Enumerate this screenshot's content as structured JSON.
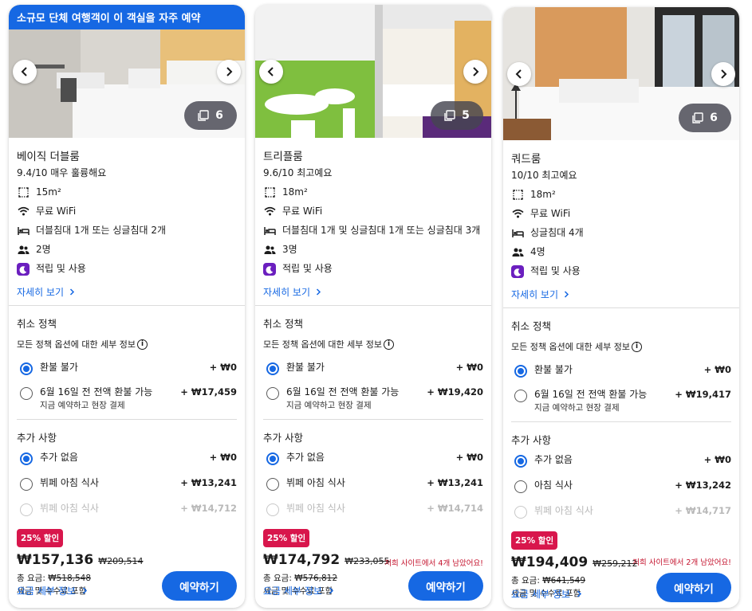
{
  "cards": [
    {
      "banner": "소규모 단체 여행객이 이 객실을 자주 예약",
      "photo_count": "6",
      "name": "베이직 더블룸",
      "rating": "9.4/10 매우 훌륭해요",
      "size": "15m²",
      "wifi": "무료 WiFi",
      "beds": "더블침대 1개 또는 싱글침대 2개",
      "guests": "2명",
      "points": "적립 및 사용",
      "details_link": "자세히 보기",
      "cancel_title": "취소 정책",
      "cancel_sub": "모든 정책 옵션에 대한 세부 정보",
      "cancel_options": [
        {
          "label": "환불 불가",
          "sub": "",
          "price": "+ ₩0"
        },
        {
          "label": "6월 16일 전 전액 환불 가능",
          "sub": "지금 예약하고 현장 결제",
          "price": "+ ₩17,459"
        }
      ],
      "extras_title": "추가 사항",
      "extras": [
        {
          "label": "추가 없음",
          "price": "+ ₩0"
        },
        {
          "label": "뷔페 아침 식사",
          "price": "+ ₩13,241"
        },
        {
          "label": "뷔페 아침 식사",
          "price": "+ ₩14,712"
        }
      ],
      "discount": "25% 할인",
      "price": "₩157,136",
      "old_price": "₩209,514",
      "total_label": "총 요금:",
      "total": "₩518,548",
      "tax": "세금 및 수수료 포함",
      "left_note": "",
      "price_link": "요금 세부 정보",
      "book": "예약하기"
    },
    {
      "banner": "",
      "photo_count": "5",
      "name": "트리플룸",
      "rating": "9.6/10 최고예요",
      "size": "18m²",
      "wifi": "무료 WiFi",
      "beds": "더블침대 1개 및 싱글침대 1개 또는 싱글침대 3개",
      "guests": "3명",
      "points": "적립 및 사용",
      "details_link": "자세히 보기",
      "cancel_title": "취소 정책",
      "cancel_sub": "모든 정책 옵션에 대한 세부 정보",
      "cancel_options": [
        {
          "label": "환불 불가",
          "sub": "",
          "price": "+ ₩0"
        },
        {
          "label": "6월 16일 전 전액 환불 가능",
          "sub": "지금 예약하고 현장 결제",
          "price": "+ ₩19,420"
        }
      ],
      "extras_title": "추가 사항",
      "extras": [
        {
          "label": "추가 없음",
          "price": "+ ₩0"
        },
        {
          "label": "뷔페 아침 식사",
          "price": "+ ₩13,241"
        },
        {
          "label": "뷔페 아침 식사",
          "price": "+ ₩14,714"
        }
      ],
      "discount": "25% 할인",
      "price": "₩174,792",
      "old_price": "₩233,055",
      "total_label": "총 요금:",
      "total": "₩576,812",
      "tax": "세금 및 수수료 포함",
      "left_note": "저희 사이트에서 4개 남았어요!",
      "price_link": "요금 세부 정보",
      "book": "예약하기"
    },
    {
      "banner": "",
      "photo_count": "6",
      "name": "쿼드룸",
      "rating": "10/10 최고예요",
      "size": "18m²",
      "wifi": "무료 WiFi",
      "beds": "싱글침대 4개",
      "guests": "4명",
      "points": "적립 및 사용",
      "details_link": "자세히 보기",
      "cancel_title": "취소 정책",
      "cancel_sub": "모든 정책 옵션에 대한 세부 정보",
      "cancel_options": [
        {
          "label": "환불 불가",
          "sub": "",
          "price": "+ ₩0"
        },
        {
          "label": "6월 16일 전 전액 환불 가능",
          "sub": "지금 예약하고 현장 결제",
          "price": "+ ₩19,417"
        }
      ],
      "extras_title": "추가 사항",
      "extras": [
        {
          "label": "추가 없음",
          "price": "+ ₩0"
        },
        {
          "label": "아침 식사",
          "price": "+ ₩13,242"
        },
        {
          "label": "뷔페 아침 식사",
          "price": "+ ₩14,717"
        }
      ],
      "discount": "25% 할인",
      "price": "₩194,409",
      "old_price": "₩259,212",
      "total_label": "총 요금:",
      "total": "₩641,549",
      "tax": "세금 및 수수료 포함",
      "left_note": "저희 사이트에서 2개 남았어요!",
      "price_link": "요금 세부 정보",
      "book": "예약하기"
    }
  ],
  "colors": {
    "accent": "#1668e3",
    "discount": "#d8164c",
    "urgency": "#c4112c",
    "points": "#6b1fbf"
  }
}
